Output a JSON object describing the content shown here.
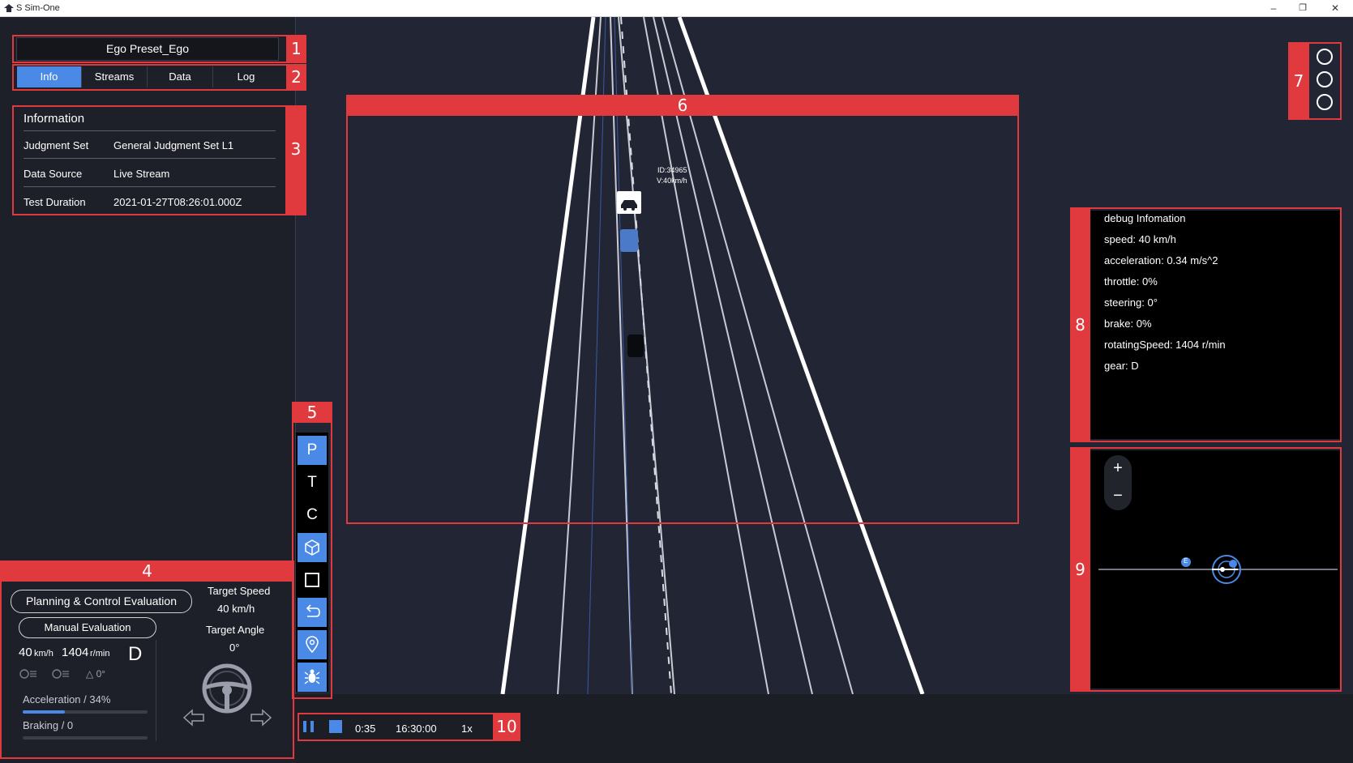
{
  "window": {
    "title": "S Sim-One",
    "minimize": "–",
    "restore": "❐",
    "close": "✕"
  },
  "annotations": [
    "1",
    "2",
    "3",
    "4",
    "5",
    "6",
    "7",
    "8",
    "9",
    "10"
  ],
  "ego": {
    "name": "Ego Preset_Ego"
  },
  "tabs": [
    {
      "label": "Info",
      "active": true
    },
    {
      "label": "Streams",
      "active": false
    },
    {
      "label": "Data",
      "active": false
    },
    {
      "label": "Log",
      "active": false
    }
  ],
  "information": {
    "title": "Information",
    "rows": [
      {
        "key": "Judgment Set",
        "value": "General Judgment Set L1"
      },
      {
        "key": "Data Source",
        "value": "Live Stream"
      },
      {
        "key": "Test Duration",
        "value": "2021-01-27T08:26:01.000Z"
      }
    ]
  },
  "evaluation": {
    "planning_button": "Planning & Control Evaluation",
    "manual_button": "Manual Evaluation",
    "speed_value": "40",
    "speed_unit": "km/h",
    "rpm_value": "1404",
    "rpm_unit": "r/min",
    "gear": "D",
    "steer_readout": "△ 0°",
    "target_speed_label": "Target Speed",
    "target_speed_value": "40 km/h",
    "target_angle_label": "Target Angle",
    "target_angle_value": "0°",
    "acceleration_label": "Acceleration / 34%",
    "acceleration_fraction": 0.34,
    "braking_label": "Braking / 0",
    "braking_fraction": 0
  },
  "toolbar": [
    {
      "label": "P",
      "active": true
    },
    {
      "label": "T",
      "active": false
    },
    {
      "label": "C",
      "active": false
    },
    {
      "icon": "cube-icon",
      "active": true
    },
    {
      "icon": "square-icon",
      "active": false
    },
    {
      "icon": "undo-icon",
      "active": true
    },
    {
      "icon": "location-pin-icon",
      "active": true
    },
    {
      "icon": "bug-icon",
      "active": true
    }
  ],
  "vehicle_tag": {
    "id": "ID:34965",
    "speed": "V:40km/h"
  },
  "debug": {
    "title": "debug Infomation",
    "lines": [
      "speed: 40 km/h",
      "acceleration: 0.34 m/s^2",
      "throttle: 0%",
      "steering: 0°",
      "brake: 0%",
      "rotatingSpeed: 1404 r/min",
      "gear: D"
    ]
  },
  "map": {
    "zoom_in": "+",
    "zoom_out": "−",
    "marker_label": "E"
  },
  "playback": {
    "elapsed": "0:35",
    "clock": "16:30:00",
    "rate": "1x"
  },
  "colors": {
    "accent": "#4a8ae6",
    "annotation": "#e0393e",
    "scene_bg": "#222634",
    "panel_bg": "#1e2029"
  }
}
